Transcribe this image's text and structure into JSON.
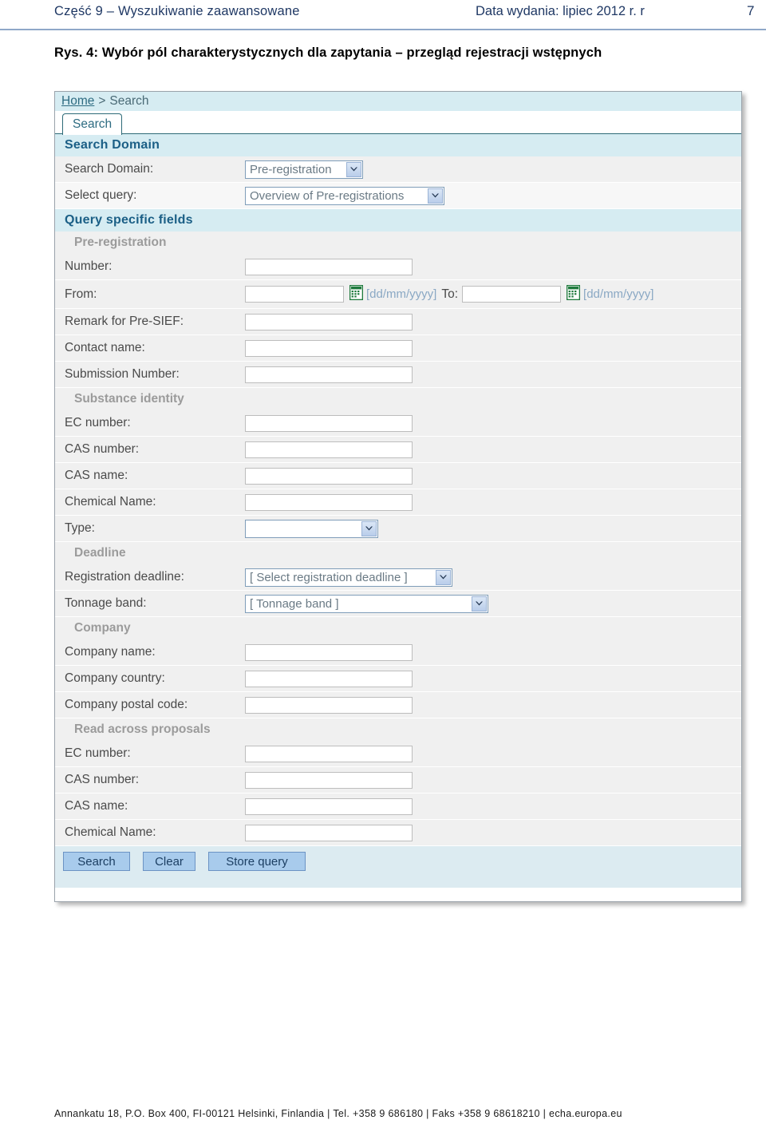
{
  "header": {
    "left_text": "Część 9 – Wyszukiwanie zaawansowane",
    "middle_text": "Data wydania: lipiec 2012 r. r",
    "page_number": "7"
  },
  "caption": {
    "text": "Rys. 4: Wybór pól charakterystycznych dla zapytania – przegląd rejestracji wstępnych"
  },
  "app": {
    "breadcrumb": {
      "home": "Home",
      "separator": ">",
      "current": "Search"
    },
    "tab": {
      "label": "Search"
    },
    "sections": {
      "search_domain_heading": "Search Domain",
      "query_specific_heading": "Query specific fields"
    },
    "search_domain": {
      "label": "Search Domain:",
      "value": "Pre-registration"
    },
    "select_query": {
      "label": "Select query:",
      "value": "Overview of Pre-registrations"
    },
    "groups": {
      "pre_registration": "Pre-registration",
      "substance_identity": "Substance identity",
      "deadline": "Deadline",
      "company": "Company",
      "read_across": "Read across proposals"
    },
    "fields": {
      "number": {
        "label": "Number:",
        "value": ""
      },
      "from": {
        "label": "From:",
        "value": "",
        "format_hint": "[dd/mm/yyyy]"
      },
      "to": {
        "label": "To:",
        "value": "",
        "format_hint": "[dd/mm/yyyy]"
      },
      "remark_presief": {
        "label": "Remark for Pre-SIEF:",
        "value": ""
      },
      "contact_name": {
        "label": "Contact name:",
        "value": ""
      },
      "submission_number": {
        "label": "Submission Number:",
        "value": ""
      },
      "si_ec_number": {
        "label": "EC number:",
        "value": ""
      },
      "si_cas_number": {
        "label": "CAS number:",
        "value": ""
      },
      "si_cas_name": {
        "label": "CAS name:",
        "value": ""
      },
      "si_chemical_name": {
        "label": "Chemical Name:",
        "value": ""
      },
      "type": {
        "label": "Type:",
        "value": ""
      },
      "registration_deadline": {
        "label": "Registration deadline:",
        "value": "[ Select registration deadline ]"
      },
      "tonnage_band": {
        "label": "Tonnage band:",
        "value": "[ Tonnage band ]"
      },
      "company_name": {
        "label": "Company name:",
        "value": ""
      },
      "company_country": {
        "label": "Company country:",
        "value": ""
      },
      "company_postal_code": {
        "label": "Company postal code:",
        "value": ""
      },
      "ra_ec_number": {
        "label": "EC number:",
        "value": ""
      },
      "ra_cas_number": {
        "label": "CAS number:",
        "value": ""
      },
      "ra_cas_name": {
        "label": "CAS name:",
        "value": ""
      },
      "ra_chemical_name": {
        "label": "Chemical Name:",
        "value": ""
      }
    },
    "buttons": {
      "search": "Search",
      "clear": "Clear",
      "store_query": "Store query"
    },
    "icons": {
      "calendar": "calendar-icon",
      "dropdown": "chevron-down-icon"
    },
    "colors": {
      "breadcrumb_bg": "#D6ECF2",
      "section_heading_text": "#1b5f86",
      "tab_border": "#2e6b78",
      "button_bg": "#A8CBEC",
      "calendar_icon": "#1f7a3d",
      "hint_text": "#8aa8c4"
    }
  },
  "footer": {
    "text": "Annankatu 18, P.O. Box 400, FI-00121 Helsinki, Finlandia | Tel. +358 9 686180 | Faks +358 9 68618210 | echa.europa.eu"
  }
}
